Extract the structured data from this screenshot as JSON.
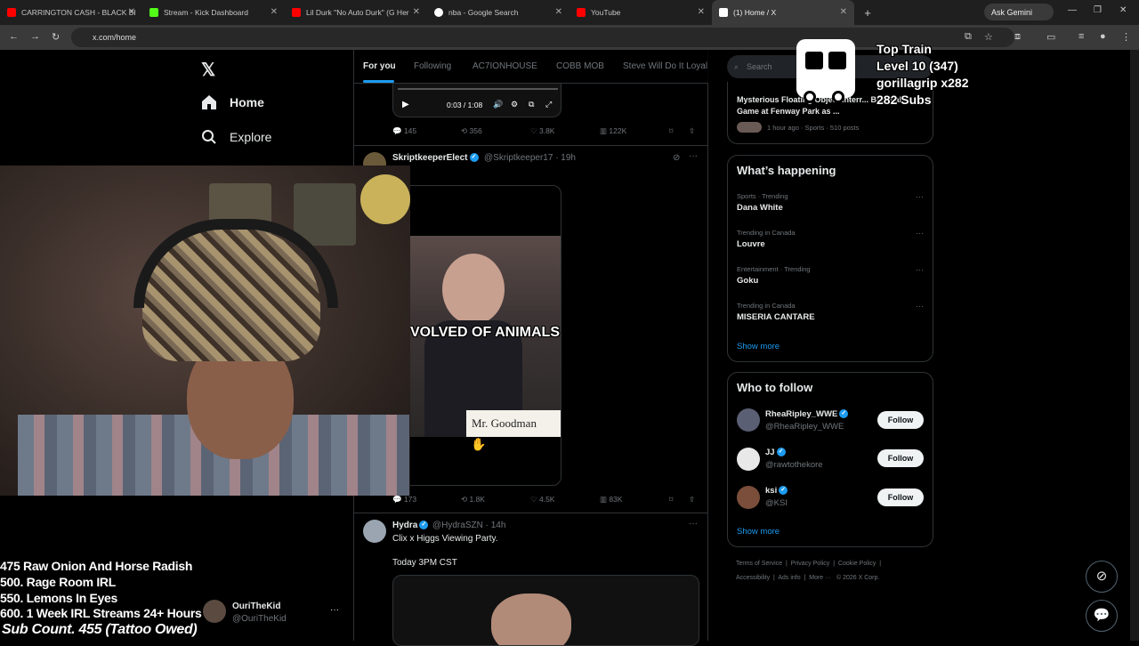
{
  "browser": {
    "tabs": [
      {
        "title": "CARRINGTON CASH - BLACK BI",
        "color": "#ff0000"
      },
      {
        "title": "Stream - Kick Dashboard",
        "color": "#53fc18"
      },
      {
        "title": "Lil Durk \"No Auto Durk\" (G Her",
        "color": "#ff0000"
      },
      {
        "title": "nba - Google Search",
        "color": "#ffffff"
      },
      {
        "title": "YouTube",
        "color": "#ff0000"
      },
      {
        "title": "(1) Home / X",
        "color": "#ffffff"
      }
    ],
    "gemini_label": "Ask Gemini",
    "url": "x.com/home"
  },
  "xnav": {
    "logo": "𝕏",
    "home": "Home",
    "explore": "Explore"
  },
  "feed": {
    "tabs": [
      "For you",
      "Following",
      "AC7IONHOUSE",
      "COBB MOB",
      "Steve Will Do It Loyal"
    ],
    "video_time": "0:03 / 1:08",
    "post1_stats": {
      "replies": "145",
      "reposts": "356",
      "likes": "3.8K",
      "views": "122K"
    },
    "post2": {
      "name": "SkriptkeeperElect",
      "handle": "@Skriptkeeper17 · 19h",
      "caption": "INVOLVED OF ANIMALS",
      "nameplate": "Mr. Goodman",
      "stats": {
        "replies": "173",
        "reposts": "1.8K",
        "likes": "4.5K",
        "views": "83K"
      }
    },
    "post3": {
      "name": "Hydra",
      "handle": "@HydraSZN · 14h",
      "line1": "Clix x Higgs Viewing Party.",
      "line2": "Today 3PM CST"
    }
  },
  "sidebar": {
    "search_placeholder": "Search",
    "top_story": {
      "title": "Mysterious Floating Object Interr... Baseball Game at Fenway Park as ...",
      "meta": "1 hour ago · Sports · 510 posts"
    },
    "whats_happening": {
      "heading": "What’s happening",
      "trends": [
        {
          "meta": "Sports · Trending",
          "name": "Dana White"
        },
        {
          "meta": "Trending in Canada",
          "name": "Louvre"
        },
        {
          "meta": "Entertainment · Trending",
          "name": "Goku"
        },
        {
          "meta": "Trending in Canada",
          "name": "MISERIA CANTARE"
        }
      ],
      "show_more": "Show more"
    },
    "who_to_follow": {
      "heading": "Who to follow",
      "accounts": [
        {
          "name": "RheaRipley_WWE",
          "handle": "@RheaRipley_WWE"
        },
        {
          "name": "JJ",
          "handle": "@rawtothekore"
        },
        {
          "name": "ksi",
          "handle": "@KSI"
        }
      ],
      "follow_label": "Follow",
      "show_more": "Show more"
    },
    "footer": {
      "line1": [
        "Terms of Service",
        "Privacy Policy",
        "Cookie Policy"
      ],
      "line2": [
        "Accessibility",
        "Ads info",
        "More ···",
        "© 2026 X Corp."
      ]
    }
  },
  "overlay": {
    "goals": [
      "475 Raw Onion And Horse Radish",
      "500. Rage Room IRL",
      "550. Lemons In Eyes",
      "600. 1 Week IRL Streams 24+ Hours"
    ],
    "sub_count": "Sub Count. 455 (Tattoo Owed)",
    "train": {
      "title": "Top Train",
      "level": "Level 10  (347)",
      "user": "gorillagrip x282",
      "subs": "282 Subs"
    },
    "account": {
      "name": "OuriTheKid",
      "handle": "@OuriTheKid"
    }
  },
  "colors": {
    "accent": "#1d9bf0",
    "background": "#000000",
    "border": "#2f3336",
    "muted": "#71767b"
  }
}
